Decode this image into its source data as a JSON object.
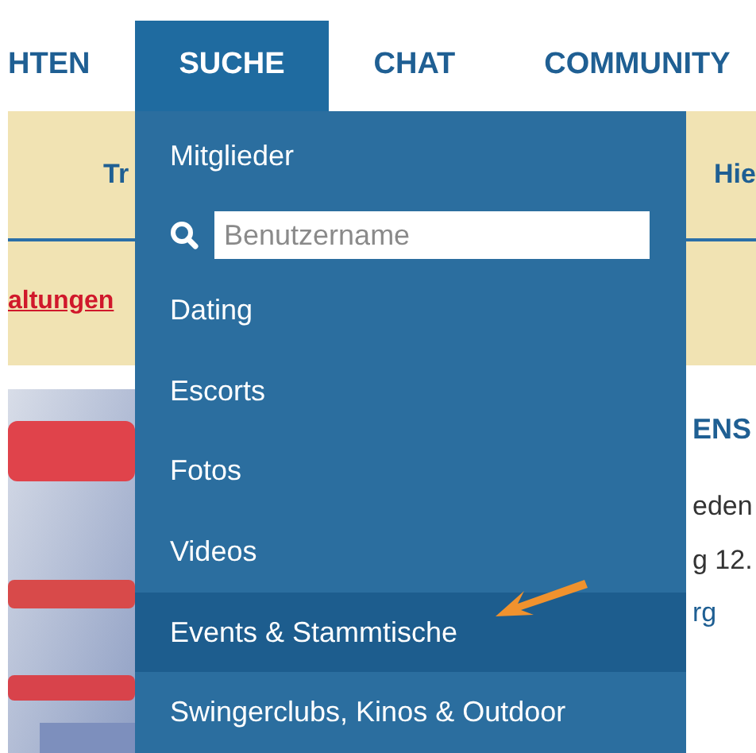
{
  "nav": {
    "tabs": [
      {
        "label": "HTEN",
        "selected": false
      },
      {
        "label": "SUCHE",
        "selected": true
      },
      {
        "label": "CHAT",
        "selected": false
      },
      {
        "label": "COMMUNITY",
        "selected": false
      }
    ]
  },
  "subnav": {
    "items": [
      "Tr",
      "Hie"
    ]
  },
  "breadcrumb": {
    "link": "altungen"
  },
  "event": {
    "title": "ENS",
    "lines": [
      "eden",
      "g 12."
    ],
    "location": "rg"
  },
  "menu": {
    "items": [
      {
        "kind": "link",
        "label": "Mitglieder",
        "hovered": false
      },
      {
        "kind": "search",
        "placeholder": "Benutzername"
      },
      {
        "kind": "link",
        "label": "Dating",
        "hovered": false
      },
      {
        "kind": "link",
        "label": "Escorts",
        "hovered": false
      },
      {
        "kind": "link",
        "label": "Fotos",
        "hovered": false
      },
      {
        "kind": "link",
        "label": "Videos",
        "hovered": false
      },
      {
        "kind": "link",
        "label": "Events & Stammtische",
        "hovered": true
      },
      {
        "kind": "link",
        "label": "Swingerclubs, Kinos & Outdoor",
        "hovered": false
      }
    ]
  }
}
